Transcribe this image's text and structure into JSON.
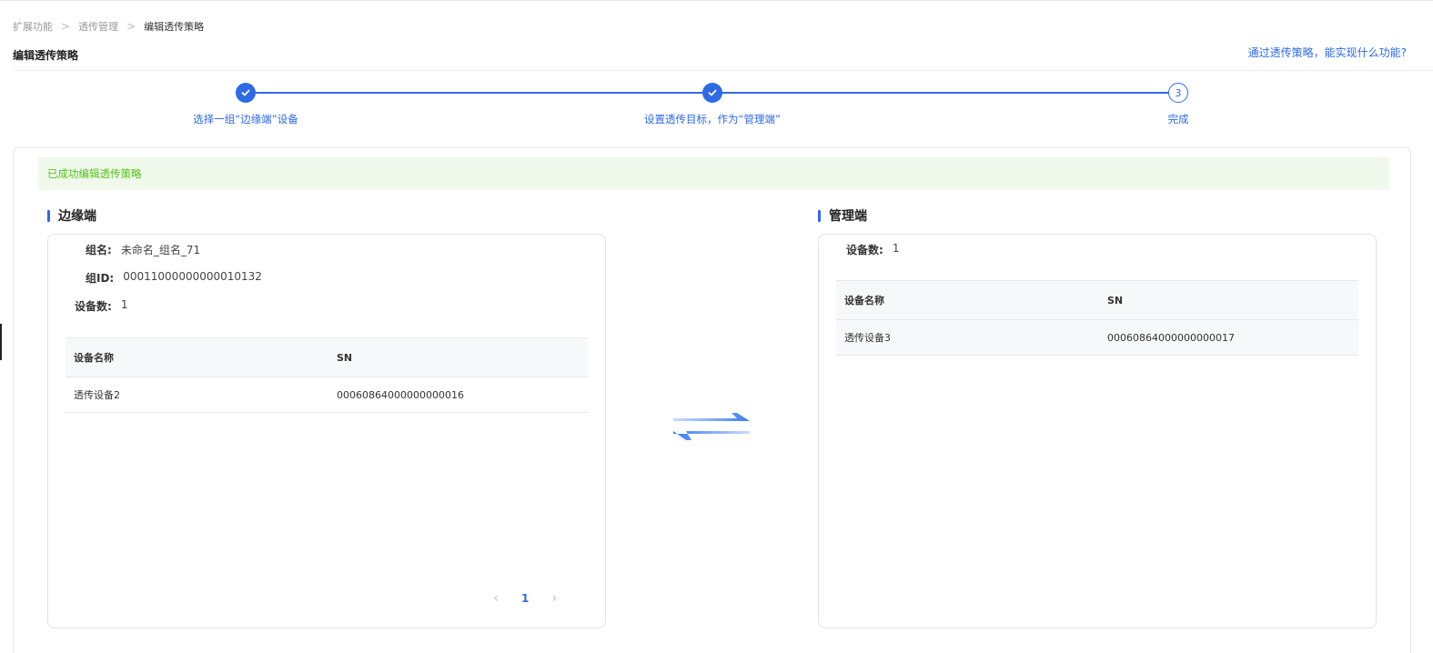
{
  "breadcrumb": {
    "items": [
      "扩展功能",
      "透传管理"
    ],
    "current": "编辑透传策略"
  },
  "page": {
    "title": "编辑透传策略",
    "help_link": "通过透传策略，能实现什么功能?"
  },
  "steps": [
    {
      "label": "选择一组“边缘端”设备",
      "status": "done"
    },
    {
      "label": "设置透传目标，作为“管理端”",
      "status": "done"
    },
    {
      "label": "完成",
      "status": "current",
      "number": "3"
    }
  ],
  "success_message": "已成功编辑透传策略",
  "edge": {
    "title": "边缘端",
    "group_name_label": "组名:",
    "group_name": "未命名_组名_71",
    "group_id_label": "组ID:",
    "group_id": "00011000000000010132",
    "device_count_label": "设备数:",
    "device_count": "1",
    "columns": [
      "设备名称",
      "SN"
    ],
    "rows": [
      {
        "name": "透传设备2",
        "sn": "00060864000000000016"
      }
    ],
    "pagination": {
      "current_page": "1",
      "prev": "‹",
      "next": "›"
    }
  },
  "manager": {
    "title": "管理端",
    "device_count_label": "设备数:",
    "device_count": "1",
    "columns": [
      "设备名称",
      "SN"
    ],
    "rows": [
      {
        "name": "透传设备3",
        "sn": "00060864000000000017"
      }
    ]
  },
  "icons": {
    "step_done": "check-icon",
    "swap": "swap-arrows-icon"
  },
  "colors": {
    "primary": "#2e6ae6",
    "success_text": "#52c41a",
    "success_bg": "#f0f9ec"
  }
}
